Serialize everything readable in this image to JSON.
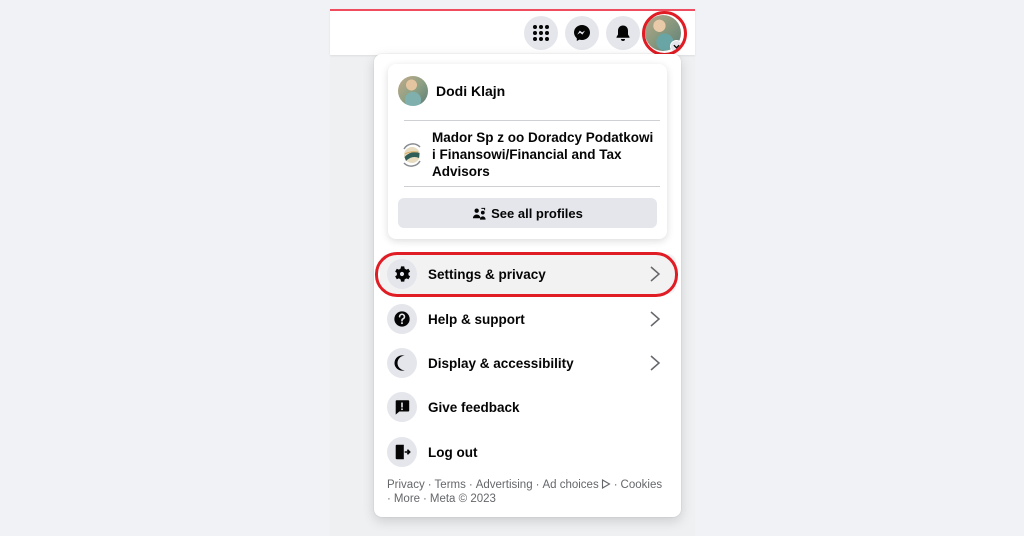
{
  "topbar": {
    "buttons": [
      {
        "name": "menu",
        "icon": "grid-icon"
      },
      {
        "name": "messenger",
        "icon": "messenger-icon"
      },
      {
        "name": "notifications",
        "icon": "bell-icon"
      }
    ],
    "account_icon": "account-avatar",
    "highlight_color": "#e01c24",
    "accent_line_color": "#ef4d5f"
  },
  "profile_card": {
    "user_name": "Dodi Klajn",
    "page_name": "Mador Sp z oo Doradcy Podatkowi i Finansowi/Financial and Tax Advisors",
    "see_all_label": "See all profiles"
  },
  "menu": {
    "items": [
      {
        "label": "Settings & privacy",
        "icon": "gear-icon",
        "has_chevron": true,
        "highlighted": true
      },
      {
        "label": "Help & support",
        "icon": "question-icon",
        "has_chevron": true
      },
      {
        "label": "Display & accessibility",
        "icon": "moon-icon",
        "has_chevron": true
      },
      {
        "label": "Give feedback",
        "icon": "feedback-icon",
        "has_chevron": false
      },
      {
        "label": "Log out",
        "icon": "logout-icon",
        "has_chevron": false
      }
    ]
  },
  "footer": {
    "links": [
      "Privacy",
      "Terms",
      "Advertising",
      "Ad choices",
      "Cookies",
      "More"
    ],
    "copyright": "Meta © 2023",
    "separator": "·"
  }
}
